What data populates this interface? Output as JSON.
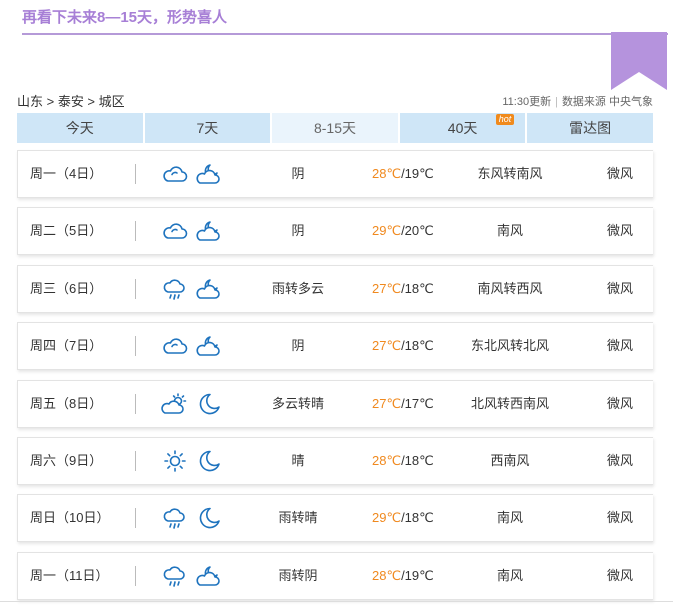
{
  "headline": "再看下未来8—15天，形势喜人",
  "breadcrumb": "山东 > 泰安 > 城区",
  "update_time": "11:30更新",
  "data_source": "数据来源 中央气象",
  "tabs": [
    {
      "label": "今天"
    },
    {
      "label": "7天"
    },
    {
      "label": "8-15天"
    },
    {
      "label": "40天",
      "badge": "hot"
    },
    {
      "label": "雷达图"
    }
  ],
  "active_tab": "8-15天",
  "colors": {
    "high_temp": "#f0891e",
    "tab_bg": "#cfe6f7",
    "tab_active_bg": "#eaf4fc",
    "headline": "#a77fd6",
    "icon": "#1e73be"
  },
  "forecast": [
    {
      "day": "周一（4日）",
      "icon_day": "cloudy-icon",
      "icon_night": "night-cloudy-icon",
      "condition": "阴",
      "high": "28℃",
      "low": "/19℃",
      "wind": "东风转南风",
      "level": "微风"
    },
    {
      "day": "周二（5日）",
      "icon_day": "cloudy-icon",
      "icon_night": "night-cloudy-icon",
      "condition": "阴",
      "high": "29℃",
      "low": "/20℃",
      "wind": "南风",
      "level": "微风"
    },
    {
      "day": "周三（6日）",
      "icon_day": "rain-icon",
      "icon_night": "night-cloudy-icon",
      "condition": "雨转多云",
      "high": "27℃",
      "low": "/18℃",
      "wind": "南风转西风",
      "level": "微风"
    },
    {
      "day": "周四（7日）",
      "icon_day": "cloudy-icon",
      "icon_night": "night-cloudy-icon",
      "condition": "阴",
      "high": "27℃",
      "low": "/18℃",
      "wind": "东北风转北风",
      "level": "微风"
    },
    {
      "day": "周五（8日）",
      "icon_day": "partly-cloudy-icon",
      "icon_night": "moon-icon",
      "condition": "多云转晴",
      "high": "27℃",
      "low": "/17℃",
      "wind": "北风转西南风",
      "level": "微风"
    },
    {
      "day": "周六（9日）",
      "icon_day": "sun-icon",
      "icon_night": "moon-icon",
      "condition": "晴",
      "high": "28℃",
      "low": "/18℃",
      "wind": "西南风",
      "level": "微风"
    },
    {
      "day": "周日（10日）",
      "icon_day": "rain-icon",
      "icon_night": "moon-icon",
      "condition": "雨转晴",
      "high": "29℃",
      "low": "/18℃",
      "wind": "南风",
      "level": "微风"
    },
    {
      "day": "周一（11日）",
      "icon_day": "rain-icon",
      "icon_night": "night-cloudy-icon",
      "condition": "雨转阴",
      "high": "28℃",
      "low": "/19℃",
      "wind": "南风",
      "level": "微风"
    }
  ]
}
